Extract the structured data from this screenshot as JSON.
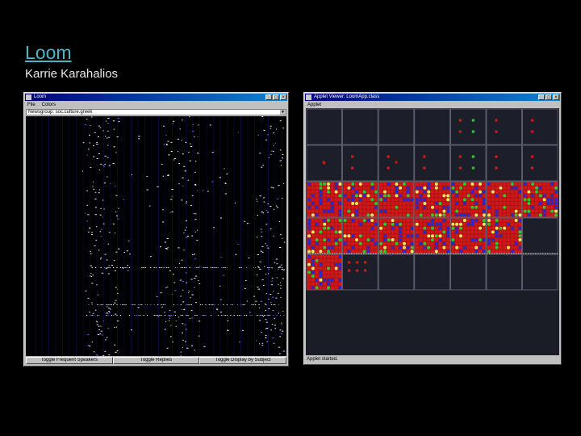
{
  "slide": {
    "title": "Loom",
    "subtitle": "Karrie Karahalios"
  },
  "left_window": {
    "title": "Loom",
    "menu": [
      "File",
      "Colors"
    ],
    "newsgroup_select": "Newsgroup: soc.culture.greek",
    "buttons": [
      "Toggle Frequent Speakers",
      "Toggle Replies",
      "Toggle Display by Subject"
    ]
  },
  "right_window": {
    "title": "Applet Viewer: LoomApp.class",
    "menu_label": "Applet",
    "status_text": "Applet started."
  },
  "titlebar_buttons": [
    "_",
    "□",
    "×"
  ],
  "colors": {
    "accent_title": "#49b6c6",
    "titlebar": "#00007b",
    "cell_red": "#d01818",
    "dot_green": "#2ec82e",
    "dot_blue": "#2828d0"
  },
  "grid_state": [
    "eeeemmm",
    "smmmmmm",
    "fffffff",
    "ffffffe",
    "fpeeeee"
  ]
}
